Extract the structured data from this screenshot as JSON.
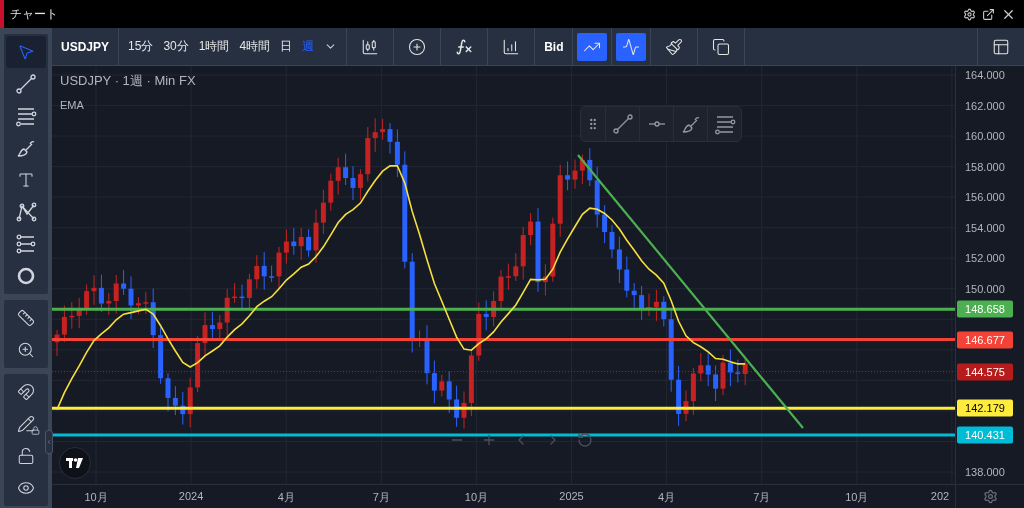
{
  "window": {
    "title": "チャート"
  },
  "toolbar": {
    "symbol": "USDJPY",
    "intervals": [
      {
        "label": "15分",
        "selected": false
      },
      {
        "label": "30分",
        "selected": false
      },
      {
        "label": "1時間",
        "selected": false
      },
      {
        "label": "4時間",
        "selected": false
      },
      {
        "label": "日",
        "selected": false
      },
      {
        "label": "週",
        "selected": true
      }
    ],
    "price_type": "Bid",
    "toggles": [
      {
        "kind": "trend",
        "on": true
      },
      {
        "kind": "pulse",
        "on": true
      }
    ]
  },
  "sidebar": {
    "groups": [
      [
        {
          "kind": "cursor",
          "selected": true
        },
        {
          "kind": "trendline",
          "selected": false
        },
        {
          "kind": "hlines",
          "selected": false
        },
        {
          "kind": "brush",
          "selected": false
        },
        {
          "kind": "text",
          "selected": false
        },
        {
          "kind": "pattern",
          "selected": false
        },
        {
          "kind": "fib",
          "selected": false
        },
        {
          "kind": "circle",
          "selected": false
        }
      ],
      [
        {
          "kind": "ruler",
          "selected": false
        },
        {
          "kind": "zoom",
          "selected": false
        }
      ],
      [
        {
          "kind": "magnet",
          "selected": false
        },
        {
          "kind": "pencil-lock",
          "selected": false
        },
        {
          "kind": "lock",
          "selected": false
        },
        {
          "kind": "eye",
          "selected": false
        }
      ]
    ]
  },
  "chart": {
    "legend": "USDJPY · 1週 · Min FX",
    "indicators": [
      "EMA"
    ],
    "price_ticks": [
      "164.000",
      "162.000",
      "160.000",
      "158.000",
      "156.000",
      "154.000",
      "152.000",
      "150.000",
      "138.000"
    ],
    "price_lines": [
      {
        "label": "148.658",
        "color": "#4caf50",
        "kind": "solid"
      },
      {
        "label": "146.677",
        "color": "#f44336",
        "kind": "solid"
      },
      {
        "label": "144.575",
        "color": "#b71c1c",
        "kind": "dotted"
      },
      {
        "label": "142.179",
        "color": "#ffeb3b",
        "kind": "solid"
      },
      {
        "label": "140.431",
        "color": "#00bcd4",
        "kind": "solid"
      }
    ],
    "time_labels": [
      "10月",
      "2024",
      "4月",
      "7月",
      "10月",
      "2025",
      "4月",
      "7月",
      "10月",
      "202"
    ]
  }
}
